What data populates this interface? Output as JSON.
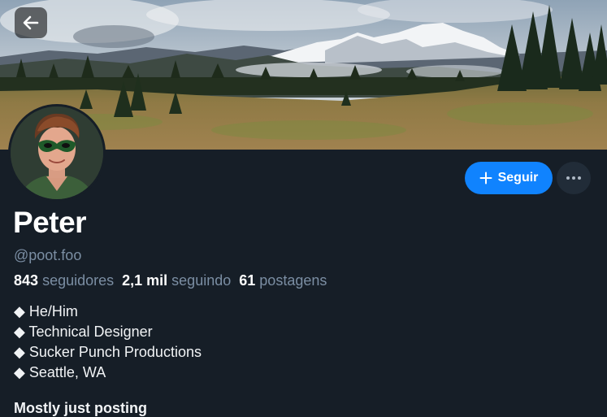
{
  "icons": {
    "back": "arrow-left-icon",
    "follow": "plus-icon",
    "more": "ellipsis-icon"
  },
  "colors": {
    "background": "#161e27",
    "accent": "#1083fe",
    "muted_text": "#7b8ea3",
    "secondary_button": "#212c38"
  },
  "profile": {
    "display_name": "Peter",
    "handle": "@poot.foo"
  },
  "actions": {
    "follow_label": "Seguir"
  },
  "stats": {
    "followers": {
      "count": "843",
      "label": "seguidores"
    },
    "following": {
      "count": "2,1 mil",
      "label": "seguindo"
    },
    "posts": {
      "count": "61",
      "label": "postagens"
    }
  },
  "bio": [
    "◆ He/Him",
    "◆ Technical Designer",
    "◆ Sucker Punch Productions",
    "◆ Seattle, WA"
  ],
  "bio_more": "Mostly just posting"
}
